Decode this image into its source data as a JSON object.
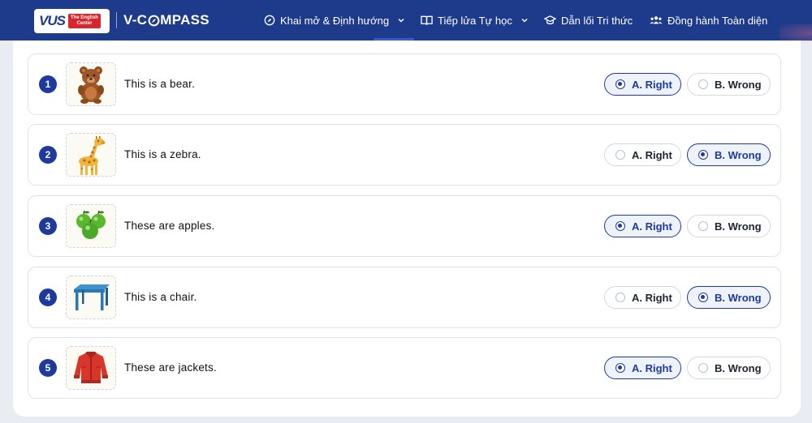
{
  "header": {
    "logo_text": "VUS",
    "logo_tag_line1": "The English",
    "logo_tag_line2": "Center",
    "brand_left": "V-C",
    "brand_right": "MPASS",
    "nav": [
      {
        "label": "Khai mở & Định hướng",
        "icon": "compass-icon",
        "dropdown": true
      },
      {
        "label": "Tiếp lửa Tự học",
        "icon": "book-icon",
        "dropdown": true
      },
      {
        "label": "Dẫn lối Tri thức",
        "icon": "graduation-cap-icon",
        "dropdown": false
      },
      {
        "label": "Đồng hành Toàn diện",
        "icon": "people-icon",
        "dropdown": false
      }
    ]
  },
  "questions": [
    {
      "number": "1",
      "text": "This is a bear.",
      "image": "bear",
      "option_a": "A. Right",
      "option_b": "B. Wrong",
      "selected": "a"
    },
    {
      "number": "2",
      "text": "This is a zebra.",
      "image": "giraffe",
      "option_a": "A. Right",
      "option_b": "B. Wrong",
      "selected": "b"
    },
    {
      "number": "3",
      "text": "These are apples.",
      "image": "apples",
      "option_a": "A. Right",
      "option_b": "B. Wrong",
      "selected": "a"
    },
    {
      "number": "4",
      "text": "This is a chair.",
      "image": "table",
      "option_a": "A. Right",
      "option_b": "B. Wrong",
      "selected": "b"
    },
    {
      "number": "5",
      "text": "These are jackets.",
      "image": "jacket",
      "option_a": "A. Right",
      "option_b": "B. Wrong",
      "selected": "a"
    }
  ],
  "colors": {
    "header_bg": "#1e3a8a",
    "accent": "#1e3a9e",
    "selected_bg": "#eef2fb",
    "logo_red": "#d7262e"
  }
}
